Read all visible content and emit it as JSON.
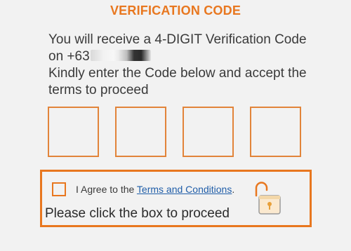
{
  "header": {
    "title": "VERIFICATION CODE"
  },
  "message": {
    "line1": "You will receive a 4-DIGIT Verification Code",
    "line2_prefix": "on +63",
    "line3": "Kindly enter the Code below and accept the",
    "line4": "terms to proceed"
  },
  "code_inputs": {
    "digit_count": 4,
    "values": [
      "",
      "",
      "",
      ""
    ]
  },
  "agreement": {
    "prefix": "I Agree to the ",
    "link_label": "Terms and Conditions",
    "suffix": ".",
    "instruction": "Please click the box to proceed",
    "checked": false,
    "lock_state": "unlocked"
  },
  "colors": {
    "accent": "#e8771f",
    "box_border": "#e2843a",
    "link": "#1f5da8",
    "background": "#f2f2f2"
  },
  "icons": {
    "lock": "open-padlock-icon",
    "checkbox": "checkbox-unchecked"
  }
}
